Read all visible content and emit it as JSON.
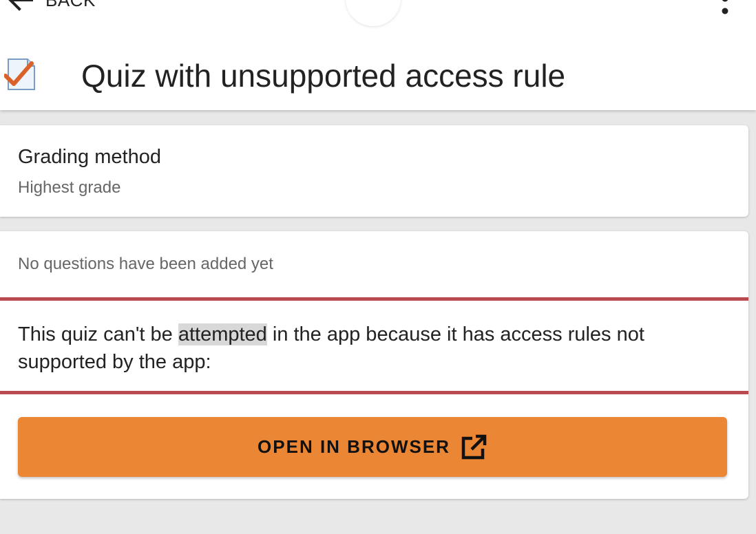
{
  "header": {
    "back_label": "BACK",
    "title": "Quiz with unsupported access rule"
  },
  "icons": {
    "back": "arrow-left-icon",
    "more": "more-vertical-icon",
    "quiz": "quiz-checkmark-icon",
    "external": "open-external-icon"
  },
  "grading": {
    "label": "Grading method",
    "value": "Highest grade"
  },
  "info": {
    "no_questions": "No questions have been added yet",
    "warning_before": "This quiz can't be ",
    "warning_highlight": "attempted",
    "warning_after": " in the app because it has access rules not supported by the app:"
  },
  "actions": {
    "open_browser_label": "OPEN IN BROWSER"
  },
  "colors": {
    "accent": "#ea8634",
    "warning_border": "#b94a4f",
    "background": "#e8e8e8"
  }
}
